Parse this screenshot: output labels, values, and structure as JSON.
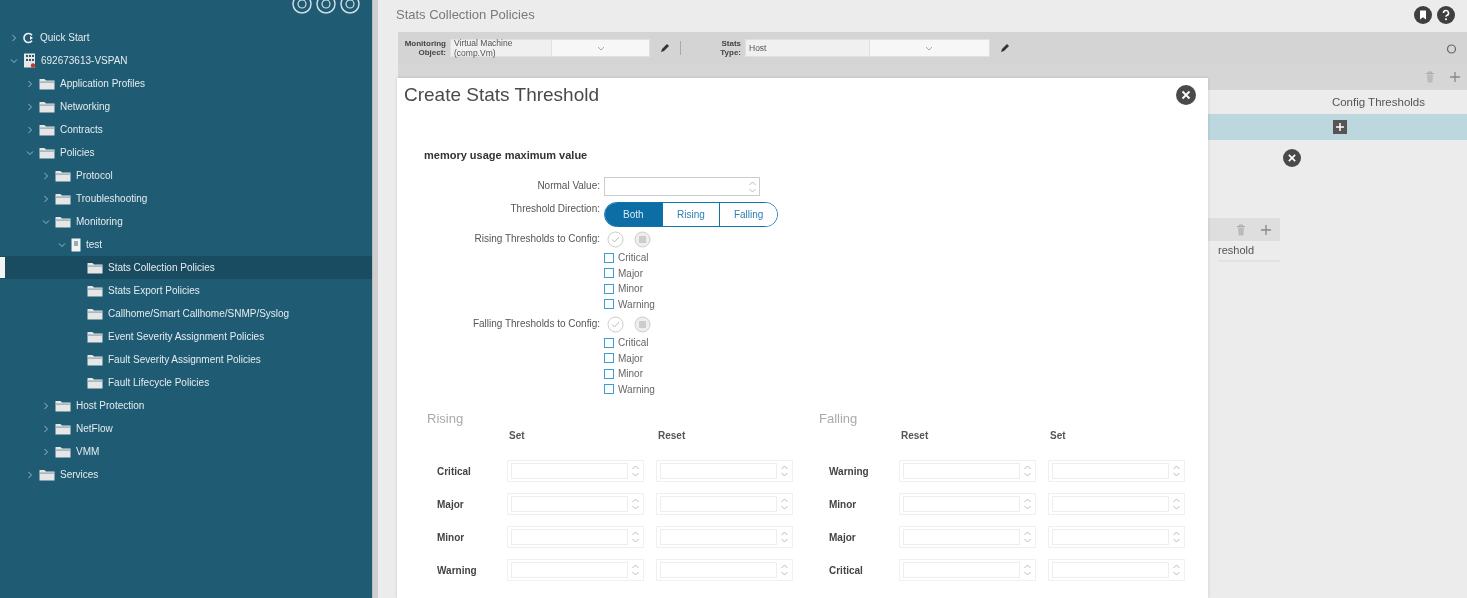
{
  "sidebar": {
    "items": [
      {
        "label": "Quick Start",
        "kind": "start",
        "expanded": false,
        "selected": false
      },
      {
        "label": "692673613-VSPAN",
        "kind": "tenant",
        "expanded": true,
        "selected": false,
        "children": [
          {
            "label": "Application Profiles",
            "kind": "folder",
            "expanded": false,
            "selected": false
          },
          {
            "label": "Networking",
            "kind": "folder",
            "expanded": false,
            "selected": false
          },
          {
            "label": "Contracts",
            "kind": "folder",
            "expanded": false,
            "selected": false
          },
          {
            "label": "Policies",
            "kind": "folder",
            "expanded": true,
            "selected": false,
            "children": [
              {
                "label": "Protocol",
                "kind": "folder",
                "expanded": false,
                "selected": false
              },
              {
                "label": "Troubleshooting",
                "kind": "folder",
                "expanded": false,
                "selected": false
              },
              {
                "label": "Monitoring",
                "kind": "folder",
                "expanded": true,
                "selected": false,
                "children": [
                  {
                    "label": "test",
                    "kind": "policy",
                    "expanded": true,
                    "selected": false,
                    "children": [
                      {
                        "label": "Stats Collection Policies",
                        "kind": "folder",
                        "selected": true
                      },
                      {
                        "label": "Stats Export Policies",
                        "kind": "folder",
                        "selected": false
                      },
                      {
                        "label": "Callhome/Smart Callhome/SNMP/Syslog",
                        "kind": "folder",
                        "selected": false
                      },
                      {
                        "label": "Event Severity Assignment Policies",
                        "kind": "folder",
                        "selected": false
                      },
                      {
                        "label": "Fault Severity Assignment Policies",
                        "kind": "folder",
                        "selected": false
                      },
                      {
                        "label": "Fault Lifecycle Policies",
                        "kind": "folder",
                        "selected": false
                      }
                    ]
                  }
                ]
              },
              {
                "label": "Host Protection",
                "kind": "folder",
                "expanded": false,
                "selected": false
              },
              {
                "label": "NetFlow",
                "kind": "folder",
                "expanded": false,
                "selected": false
              },
              {
                "label": "VMM",
                "kind": "folder",
                "expanded": false,
                "selected": false
              }
            ]
          },
          {
            "label": "Services",
            "kind": "folder",
            "expanded": false,
            "selected": false
          }
        ]
      }
    ]
  },
  "page": {
    "title": "Stats Collection Policies"
  },
  "toolbar": {
    "monitoring_object": {
      "label": "Monitoring Object:",
      "value": "Virtual Machine (comp.Vm)"
    },
    "stats_type": {
      "label": "Stats Type:",
      "value": "Host"
    }
  },
  "background_panel": {
    "column_header": "Config Thresholds",
    "partial_label": "reshold"
  },
  "dialog": {
    "title": "Create Stats Threshold",
    "heading": "memory usage maximum value",
    "normal_value": {
      "label": "Normal Value:"
    },
    "threshold_direction": {
      "label": "Threshold Direction:",
      "options": [
        {
          "label": "Both",
          "selected": true
        },
        {
          "label": "Rising",
          "selected": false
        },
        {
          "label": "Falling",
          "selected": false
        }
      ]
    },
    "rising_config": {
      "label": "Rising Thresholds to Config:",
      "options": [
        {
          "label": "Critical",
          "checked": false
        },
        {
          "label": "Major",
          "checked": false
        },
        {
          "label": "Minor",
          "checked": false
        },
        {
          "label": "Warning",
          "checked": false
        }
      ]
    },
    "falling_config": {
      "label": "Falling Thresholds to Config:",
      "options": [
        {
          "label": "Critical",
          "checked": false
        },
        {
          "label": "Major",
          "checked": false
        },
        {
          "label": "Minor",
          "checked": false
        },
        {
          "label": "Warning",
          "checked": false
        }
      ]
    },
    "tables": [
      {
        "title": "Rising",
        "columns": [
          "Set",
          "Reset"
        ],
        "rows": [
          "Critical",
          "Major",
          "Minor",
          "Warning"
        ]
      },
      {
        "title": "Falling",
        "columns": [
          "Reset",
          "Set"
        ],
        "rows": [
          "Warning",
          "Minor",
          "Major",
          "Critical"
        ]
      }
    ]
  }
}
